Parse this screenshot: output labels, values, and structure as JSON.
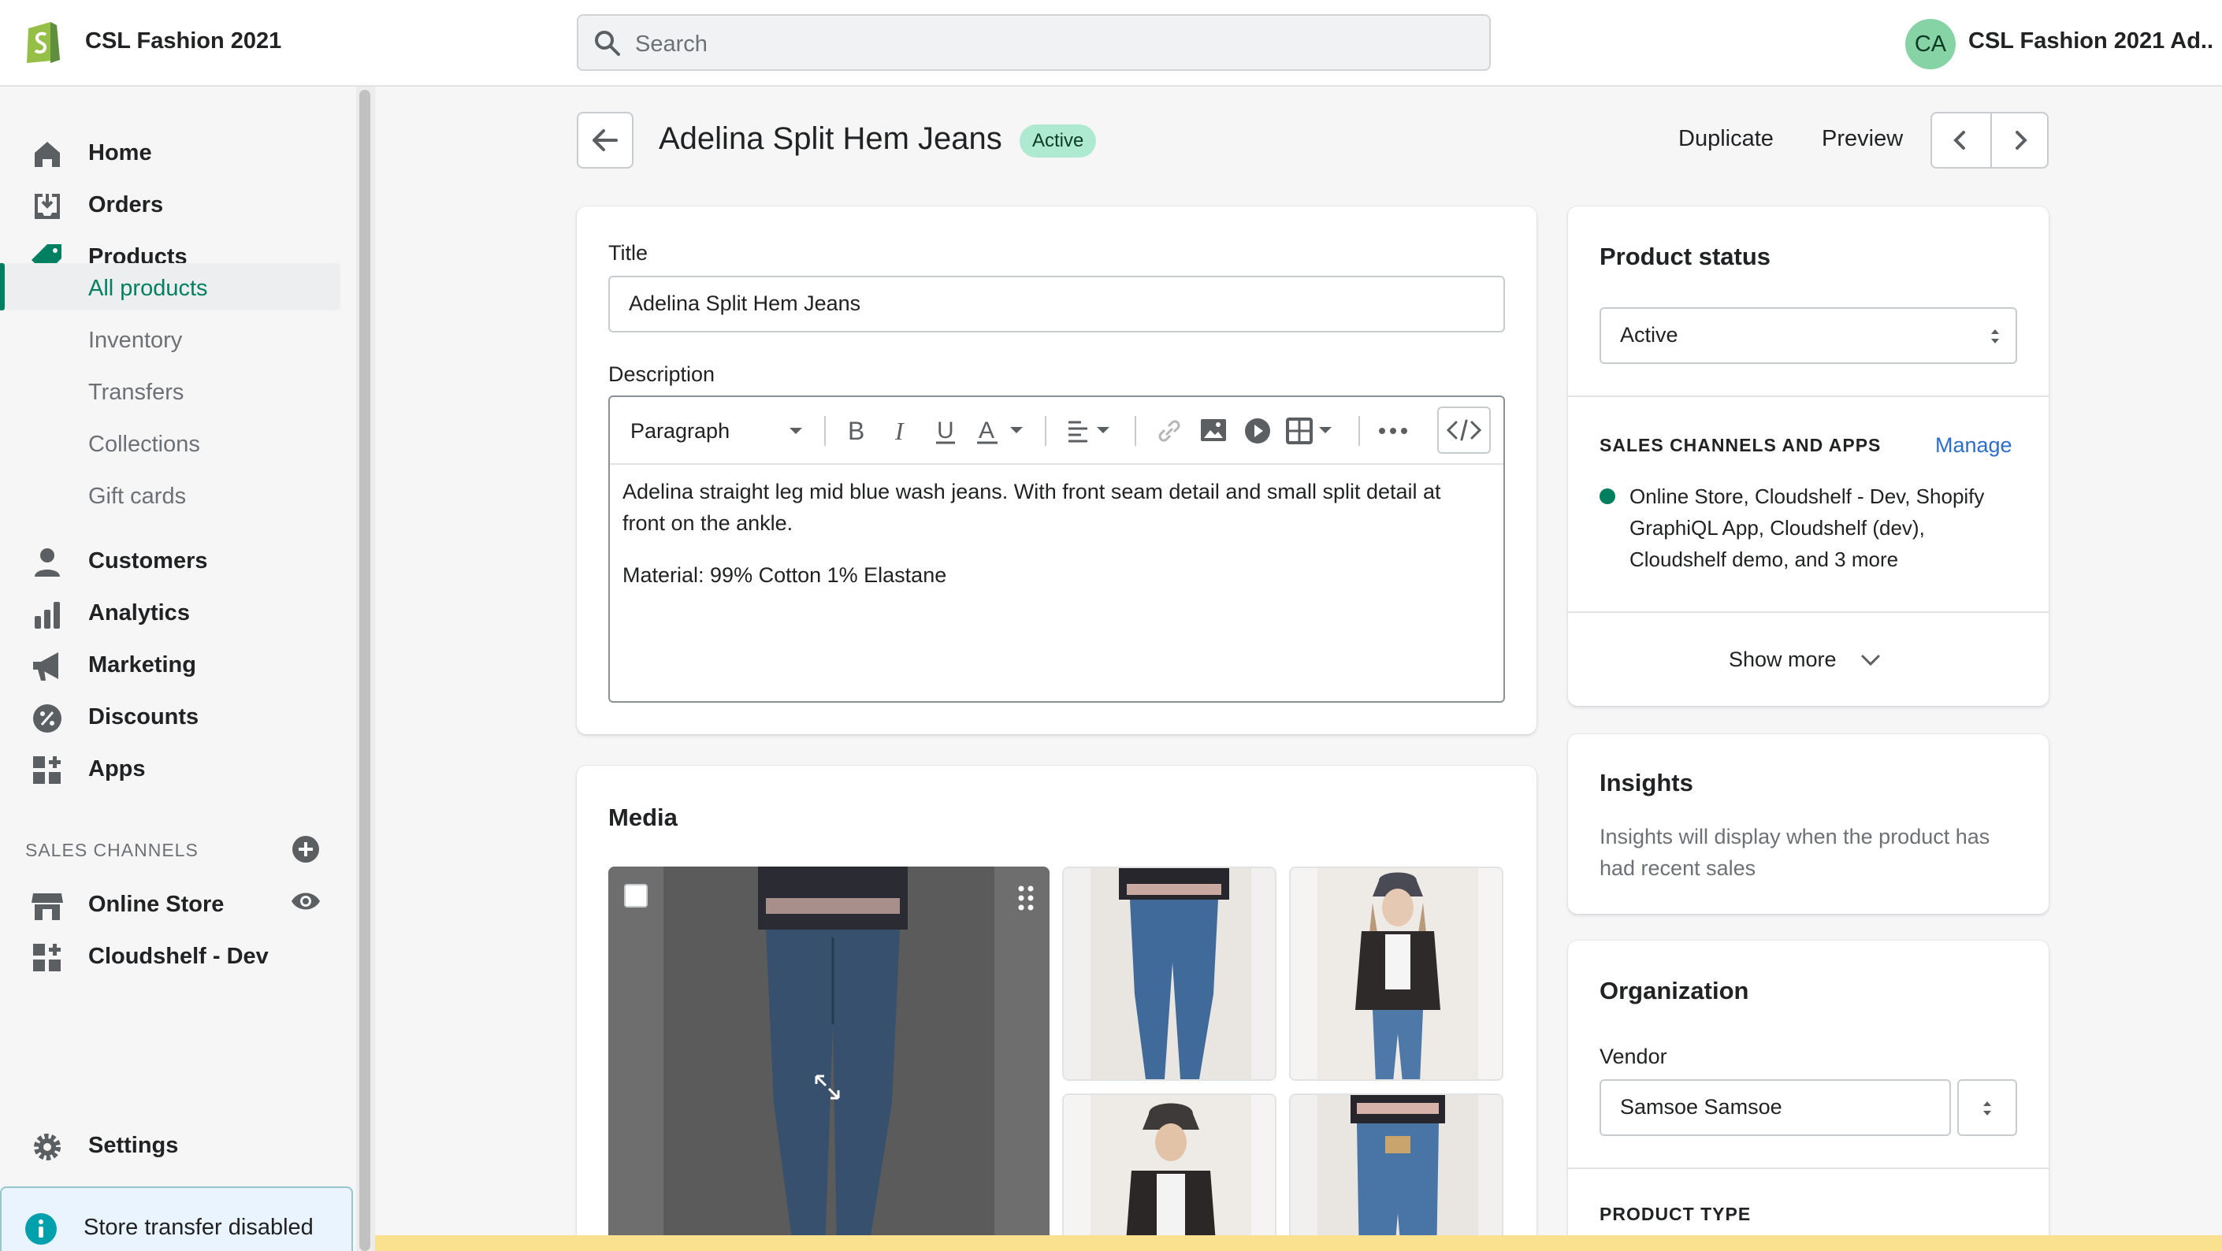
{
  "topbar": {
    "store_name": "CSL Fashion 2021",
    "search_placeholder": "Search",
    "avatar_initials": "CA",
    "user_name": "CSL Fashion 2021 Ad..."
  },
  "sidebar": {
    "nav": [
      {
        "label": "Home",
        "icon": "home-icon"
      },
      {
        "label": "Orders",
        "icon": "orders-icon"
      },
      {
        "label": "Products",
        "icon": "tag-icon"
      }
    ],
    "products_sub": [
      "All products",
      "Inventory",
      "Transfers",
      "Collections",
      "Gift cards"
    ],
    "nav2": [
      {
        "label": "Customers",
        "icon": "person-icon"
      },
      {
        "label": "Analytics",
        "icon": "bar-chart-icon"
      },
      {
        "label": "Marketing",
        "icon": "megaphone-icon"
      },
      {
        "label": "Discounts",
        "icon": "discount-icon"
      },
      {
        "label": "Apps",
        "icon": "apps-icon"
      }
    ],
    "sales_channels_title": "SALES CHANNELS",
    "channels": [
      {
        "label": "Online Store",
        "icon": "store-icon"
      },
      {
        "label": "Cloudshelf - Dev",
        "icon": "apps-icon"
      }
    ],
    "settings_label": "Settings",
    "store_transfer_text": "Store transfer disabled"
  },
  "header": {
    "title": "Adelina Split Hem Jeans",
    "status_badge": "Active",
    "duplicate_label": "Duplicate",
    "preview_label": "Preview"
  },
  "product_form": {
    "title_label": "Title",
    "title_value": "Adelina Split Hem Jeans",
    "description_label": "Description",
    "paragraph_select": "Paragraph",
    "description_p1": "Adelina straight leg mid blue wash jeans. With front seam detail and small split detail at front on the ankle.",
    "description_p2": "Material: 99% Cotton 1% Elastane"
  },
  "media": {
    "title": "Media"
  },
  "product_status": {
    "title": "Product status",
    "status_value": "Active",
    "sales_channels_title": "SALES CHANNELS AND APPS",
    "manage_label": "Manage",
    "channels_text": "Online Store, Cloudshelf - Dev, Shopify GraphiQL App, Cloudshelf (dev), Cloudshelf demo, and 3 more",
    "show_more_label": "Show more"
  },
  "insights": {
    "title": "Insights",
    "text": "Insights will display when the product has had recent sales"
  },
  "organization": {
    "title": "Organization",
    "vendor_label": "Vendor",
    "vendor_value": "Samsoe Samsoe",
    "product_type_label": "PRODUCT TYPE"
  },
  "colors": {
    "accent": "#008060",
    "link": "#2c6ecb",
    "badge_bg": "#aee9d1",
    "warning_bar": "#f9e18f"
  }
}
